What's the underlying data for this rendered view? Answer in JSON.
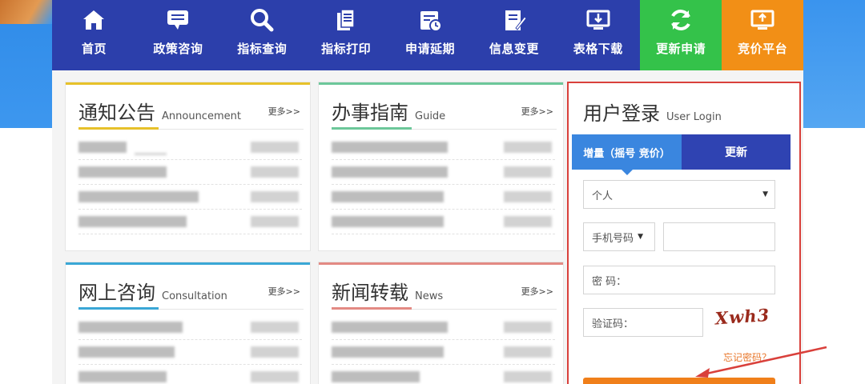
{
  "nav": [
    {
      "label": "首页",
      "icon": "home-icon"
    },
    {
      "label": "政策咨询",
      "icon": "chat-bubble-icon"
    },
    {
      "label": "指标查询",
      "icon": "search-icon"
    },
    {
      "label": "指标打印",
      "icon": "document-icon"
    },
    {
      "label": "申请延期",
      "icon": "calendar-clock-icon"
    },
    {
      "label": "信息变更",
      "icon": "edit-document-icon"
    },
    {
      "label": "表格下载",
      "icon": "monitor-download-icon"
    },
    {
      "label": "更新申请",
      "icon": "refresh-icon"
    },
    {
      "label": "竞价平台",
      "icon": "monitor-upload-icon"
    }
  ],
  "colors": {
    "nav_bg": "#2c3fab",
    "nav_green": "#34c24a",
    "nav_orange": "#f28f16",
    "announcement_line": "#e7c12a",
    "guide_line": "#6cc79a",
    "consult_line": "#3aa7d6",
    "news_line": "#e38a83",
    "login_border": "#d9403b"
  },
  "cards": {
    "announcement": {
      "title": "通知公告",
      "subtitle": "Announcement",
      "more": "更多>>"
    },
    "guide": {
      "title": "办事指南",
      "subtitle": "Guide",
      "more": "更多>>"
    },
    "consultation": {
      "title": "网上咨询",
      "subtitle": "Consultation",
      "more": "更多>>"
    },
    "news": {
      "title": "新闻转载",
      "subtitle": "News",
      "more": "更多>>"
    }
  },
  "login": {
    "title": "用户登录",
    "subtitle": "User Login",
    "tab_increment": "增量（摇号 竞价）",
    "tab_update": "更新",
    "user_type": "个人",
    "id_type": "手机号码",
    "password_label": "密 码：",
    "captcha_label": "验证码：",
    "captcha_text": "Xwh3",
    "forgot": "忘记密码？"
  }
}
